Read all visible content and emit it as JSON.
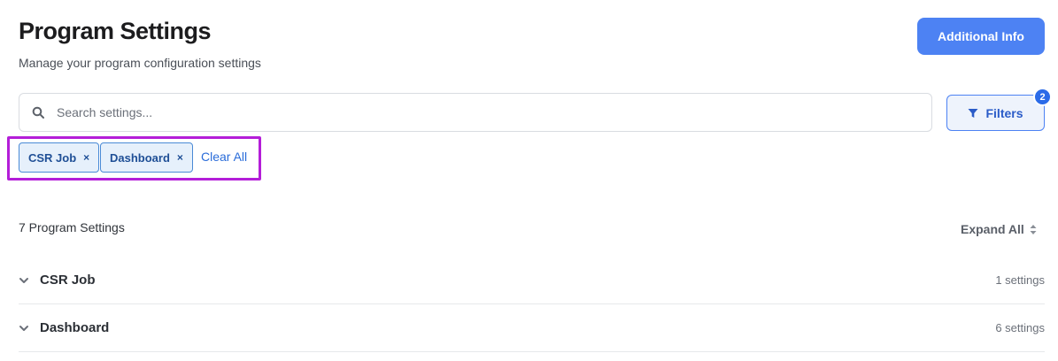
{
  "header": {
    "title": "Program Settings",
    "subtitle": "Manage your program configuration settings",
    "additional_info_label": "Additional Info"
  },
  "search": {
    "placeholder": "Search settings...",
    "icon": "search-icon"
  },
  "filters": {
    "label": "Filters",
    "icon": "funnel-icon",
    "badge_count": "2"
  },
  "active_filters": {
    "chips": [
      {
        "label": "CSR Job",
        "remove_glyph": "×"
      },
      {
        "label": "Dashboard",
        "remove_glyph": "×"
      }
    ],
    "clear_all_label": "Clear All",
    "highlight_color": "#b41ed8"
  },
  "results": {
    "count_label": "7 Program Settings",
    "expand_all_label": "Expand All",
    "groups": [
      {
        "name": "CSR Job",
        "meta": "1 settings"
      },
      {
        "name": "Dashboard",
        "meta": "6 settings"
      }
    ]
  },
  "colors": {
    "accent": "#4d82f3",
    "badge": "#2b6be8"
  }
}
